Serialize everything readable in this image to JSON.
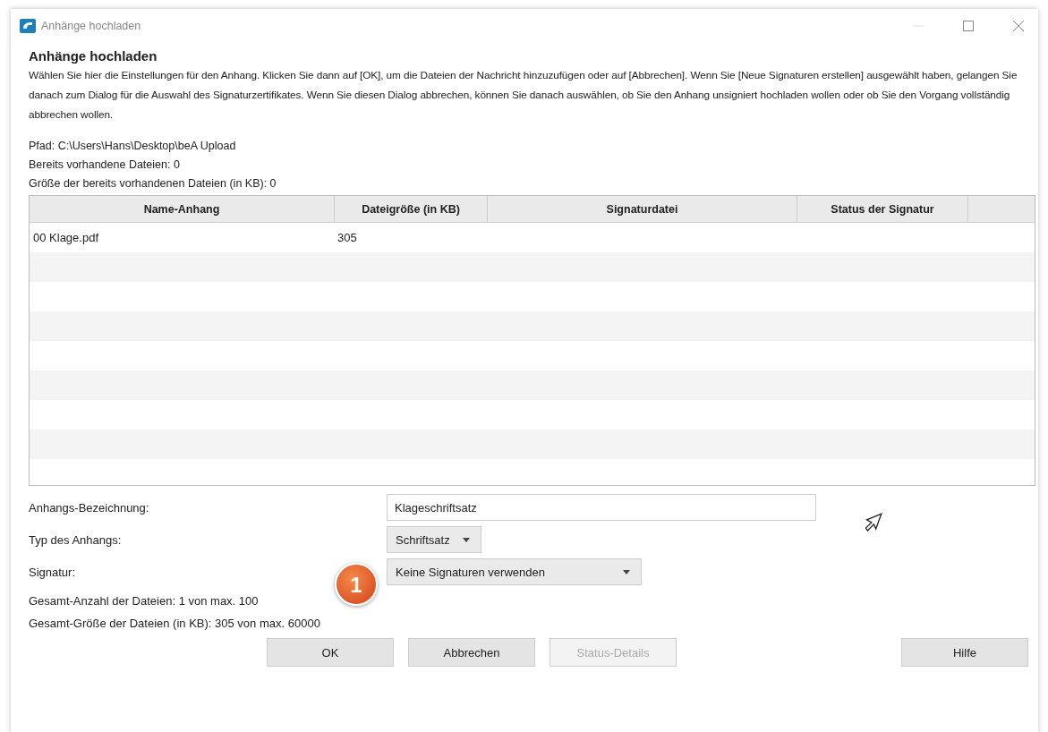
{
  "window": {
    "title": "Anhänge hochladen"
  },
  "heading": "Anhänge hochladen",
  "description": "Wählen Sie hier die Einstellungen für den Anhang. Klicken Sie dann auf [OK], um die Dateien der Nachricht hinzuzufügen oder auf [Abbrechen]. Wenn Sie [Neue Signaturen erstellen] ausgewählt haben, gelangen Sie danach zum Dialog für die Auswahl des Signaturzertifikates. Wenn Sie diesen Dialog abbrechen, können Sie danach auswählen, ob Sie den Anhang unsigniert hochladen wollen oder ob Sie den Vorgang vollständig abbrechen wollen.",
  "info_lines": [
    "Pfad: C:\\Users\\Hans\\Desktop\\beA Upload",
    "Bereits vorhandene Dateien: 0",
    "Größe der bereits vorhandenen Dateien (in KB): 0"
  ],
  "table": {
    "columns": [
      "Name-Anhang",
      "Dateigröße (in KB)",
      "Signaturdatei",
      "Status der Signatur"
    ],
    "rows": [
      [
        "00 Klage.pdf",
        "305",
        "",
        ""
      ]
    ]
  },
  "form": [
    {
      "label": "Anhangs-Bezeichnung:",
      "kind": "text",
      "value": "Klageschriftsatz"
    },
    {
      "label": "Typ des Anhangs:",
      "kind": "dropdown",
      "value": "Schriftsatz"
    },
    {
      "label": "Signatur:",
      "kind": "dropdown",
      "value": "Keine Signaturen verwenden"
    }
  ],
  "summary": [
    "Gesamt-Anzahl der Dateien: 1 von max. 100",
    "Gesamt-Größe der Dateien (in KB): 305 von max. 60000"
  ],
  "callout": "1",
  "buttons": [
    {
      "label": "OK",
      "disabled": false
    },
    {
      "label": "Abbrechen",
      "disabled": false
    },
    {
      "label": "Status-Details",
      "disabled": true
    },
    {
      "label": "Hilfe",
      "disabled": false
    }
  ]
}
